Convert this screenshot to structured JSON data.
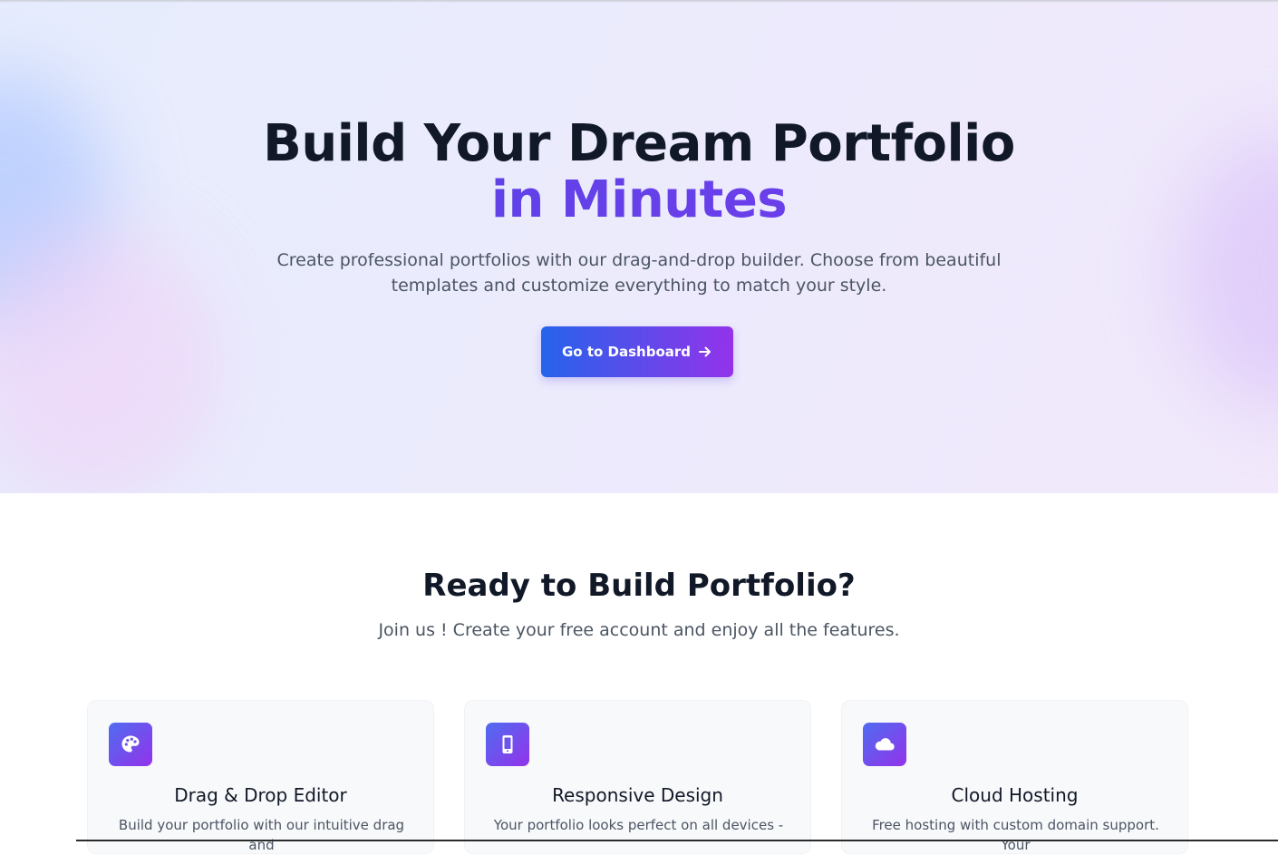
{
  "hero": {
    "title_line1": "Build Your Dream Portfolio",
    "title_line2": "in Minutes",
    "subtitle": "Create professional portfolios with our drag-and-drop builder. Choose from beautiful templates and customize everything to match your style.",
    "cta_label": "Go to Dashboard",
    "cta_icon": "arrow-right-icon"
  },
  "features_section": {
    "title": "Ready to Build Portfolio?",
    "subtitle": "Join us ! Create your free account and enjoy all the features.",
    "cards": [
      {
        "icon": "palette-icon",
        "title": "Drag & Drop Editor",
        "description": "Build your portfolio with our intuitive drag and"
      },
      {
        "icon": "mobile-icon",
        "title": "Responsive Design",
        "description": "Your portfolio looks perfect on all devices -"
      },
      {
        "icon": "cloud-icon",
        "title": "Cloud Hosting",
        "description": "Free hosting with custom domain support. Your"
      }
    ]
  },
  "colors": {
    "accent_start": "#2563eb",
    "accent_end": "#9333ea",
    "heading": "#111827",
    "body_text": "#4b5563",
    "accent_text": "#5b47e8"
  }
}
